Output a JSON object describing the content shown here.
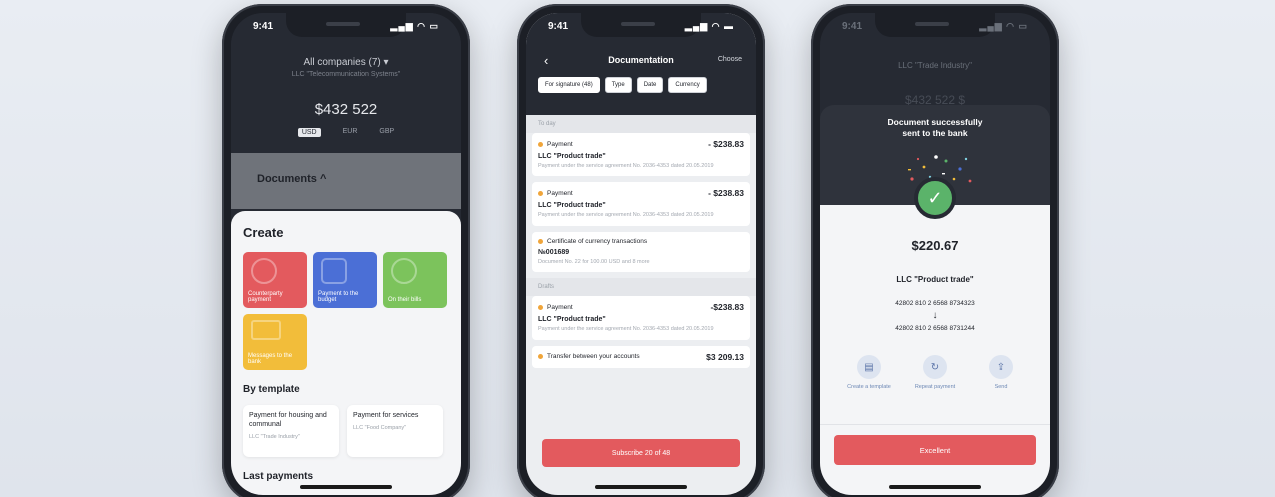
{
  "phone1": {
    "status_time": "9:41",
    "companies": "All companies (7) ▾",
    "companies_sub": "LLC \"Telecommunication Systems\"",
    "balance": "$432 522",
    "currencies": [
      "USD",
      "EUR",
      "GBP"
    ],
    "documents_label": "Documents ^",
    "create_title": "Create",
    "tiles": [
      {
        "label": "Counterparty payment",
        "color": "#e35a5e"
      },
      {
        "label": "Payment to the budget",
        "color": "#4b6fd6"
      },
      {
        "label": "On their bills",
        "color": "#7cc35c"
      },
      {
        "label": "Messages to the bank",
        "color": "#f2bd3a"
      }
    ],
    "by_template": "By template",
    "templates": [
      {
        "title": "Payment for housing and communal",
        "sub": "LLC \"Trade Industry\""
      },
      {
        "title": "Payment for services",
        "sub": "LLC \"Food Company\""
      }
    ],
    "last_payments": "Last payments"
  },
  "phone2": {
    "status_time": "9:41",
    "title": "Documentation",
    "choose": "Choose",
    "filters": [
      "For signature (48)",
      "Type",
      "Date",
      "Currency"
    ],
    "section_today": "To day",
    "section_drafts": "Drafts",
    "cards": [
      {
        "type": "Payment",
        "amount": "- $238.83",
        "name": "LLC \"Product trade\"",
        "desc": "Payment under the service agreement No. 2036-4353 dated 20.05.2019"
      },
      {
        "type": "Payment",
        "amount": "- $238.83",
        "name": "LLC \"Product trade\"",
        "desc": "Payment under the service agreement No. 2036-4353 dated 20.05.2019"
      },
      {
        "type": "Certificate of currency transactions",
        "amount": "",
        "name": "№001689",
        "desc": "Document No. 22 for 100.00 USD and 8 more"
      }
    ],
    "draft_cards": [
      {
        "type": "Payment",
        "amount": "-$238.83",
        "name": "LLC \"Product trade\"",
        "desc": "Payment under the service agreement No. 2036-4353 dated 20.05.2019"
      },
      {
        "type": "Transfer between your accounts",
        "amount": "$3 209.13",
        "name": "",
        "desc": ""
      }
    ],
    "subscribe": "Subscribe 20 of 48"
  },
  "phone3": {
    "status_time": "9:41",
    "company": "LLC \"Trade Industry\"",
    "ghost_balance": "$432 522 $",
    "success_line1": "Document successfully",
    "success_line2": "sent to the bank",
    "amount": "$220.67",
    "recipient": "LLC \"Product trade\"",
    "account_from": "42802 810 2 6568 8734323",
    "arrow": "↓",
    "account_to": "42802 810 2 6568 8731244",
    "actions": [
      {
        "label": "Create a template",
        "icon": "document-icon"
      },
      {
        "label": "Repeat payment",
        "icon": "repeat-icon"
      },
      {
        "label": "Send",
        "icon": "share-icon"
      }
    ],
    "excellent": "Excellent"
  },
  "colors": {
    "dark": "#262a33",
    "accent_red": "#e35a5e",
    "success_green": "#5bb36a"
  }
}
